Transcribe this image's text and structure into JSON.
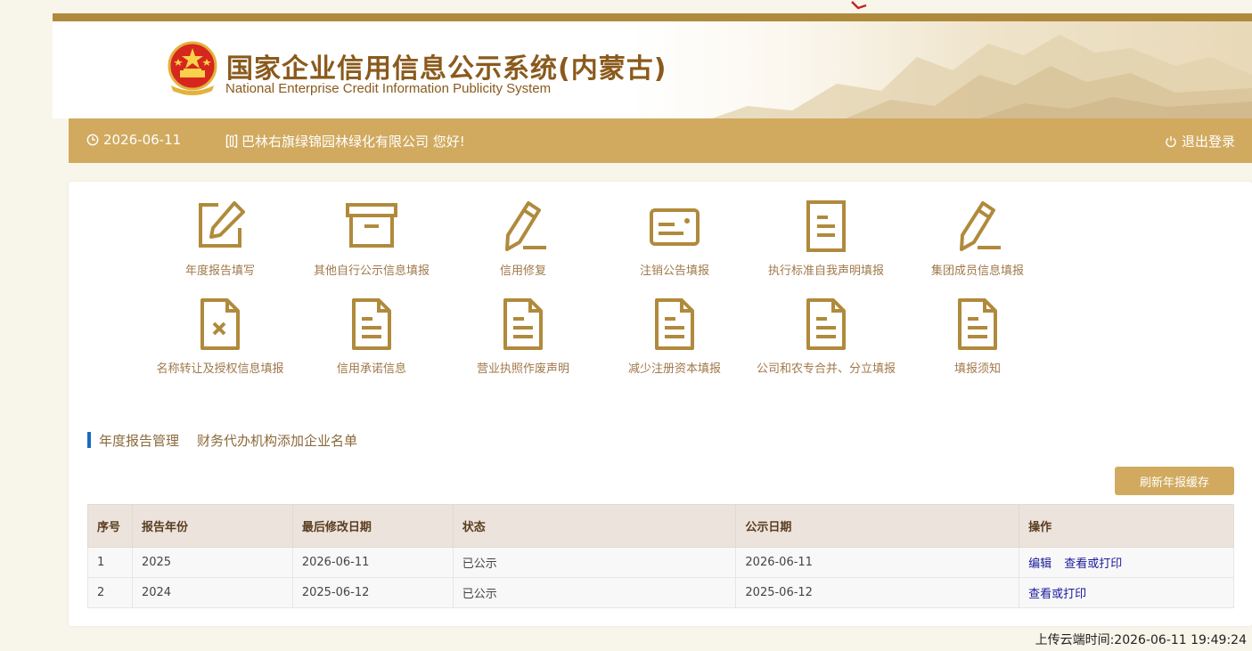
{
  "header": {
    "title_cn": "国家企业信用信息公示系统(内蒙古)",
    "title_en": "National Enterprise Credit Information Publicity System"
  },
  "infobar": {
    "date": "2026-06-11",
    "greeting": "巴林右旗绿锦园林绿化有限公司 您好!",
    "logout": "退出登录"
  },
  "menu": {
    "items": [
      {
        "label": "年度报告填写",
        "icon": "edit-square-icon"
      },
      {
        "label": "其他自行公示信息填报",
        "icon": "archive-box-icon"
      },
      {
        "label": "信用修复",
        "icon": "pencil-icon"
      },
      {
        "label": "注销公告填报",
        "icon": "card-icon"
      },
      {
        "label": "执行标准自我声明填报",
        "icon": "document-lines-icon"
      },
      {
        "label": "集团成员信息填报",
        "icon": "pencil-icon"
      },
      {
        "label": "名称转让及授权信息填报",
        "icon": "document-x-icon"
      },
      {
        "label": "信用承诺信息",
        "icon": "document-icon"
      },
      {
        "label": "营业执照作废声明",
        "icon": "document-icon"
      },
      {
        "label": "减少注册资本填报",
        "icon": "document-icon"
      },
      {
        "label": "公司和农专合并、分立填报",
        "icon": "document-icon"
      },
      {
        "label": "填报须知",
        "icon": "document-icon"
      }
    ]
  },
  "tabs": [
    "年度报告管理",
    "财务代办机构添加企业名单"
  ],
  "refresh_button": "刷新年报缓存",
  "table": {
    "headers": [
      "序号",
      "报告年份",
      "最后修改日期",
      "状态",
      "公示日期",
      "操作"
    ],
    "rows": [
      {
        "no": "1",
        "year": "2025",
        "modified": "2026-06-11",
        "status": "已公示",
        "publish": "2026-06-11",
        "edit": "编辑",
        "view": "查看或打印"
      },
      {
        "no": "2",
        "year": "2024",
        "modified": "2025-06-12",
        "status": "已公示",
        "publish": "2025-06-12",
        "view": "查看或打印"
      }
    ]
  },
  "upload_time": "上传云端时间:2026-06-11 19:49:24",
  "colors": {
    "accent": "#d1aa5f",
    "brown": "#b08a3c",
    "icon": "#b08a3c"
  }
}
